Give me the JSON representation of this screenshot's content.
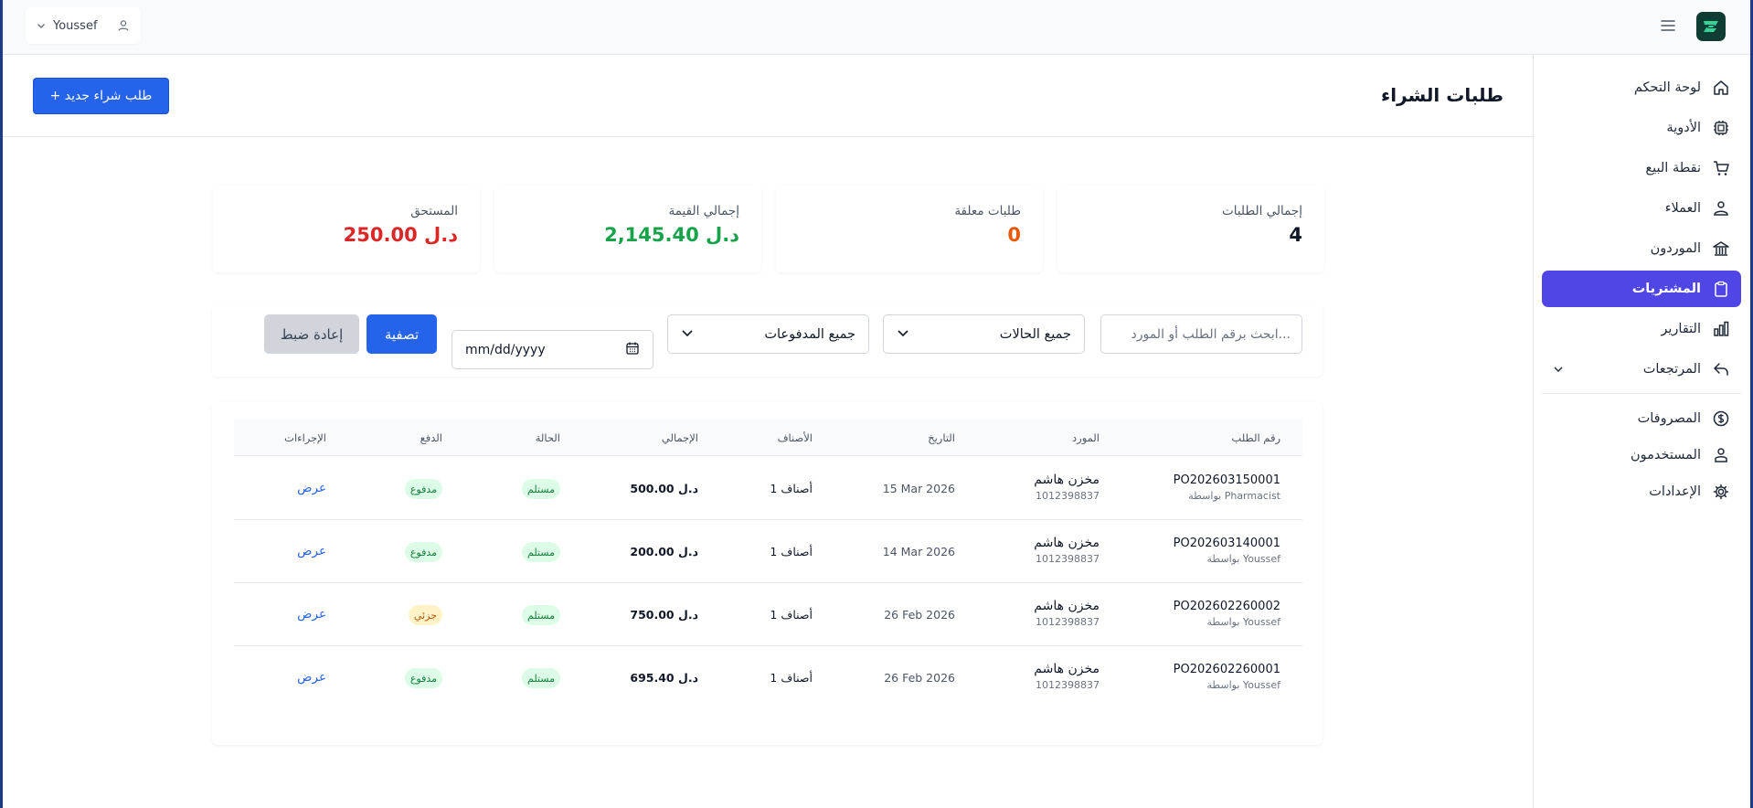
{
  "app": {
    "user_name": "Youssef"
  },
  "sidebar": {
    "items": [
      {
        "label": "لوحة التحكم",
        "icon": "home-icon",
        "active": false
      },
      {
        "label": "الأدوية",
        "icon": "pill-icon",
        "active": false
      },
      {
        "label": "نقطة البيع",
        "icon": "cart-icon",
        "active": false
      },
      {
        "label": "العملاء",
        "icon": "customers-icon",
        "active": false
      },
      {
        "label": "الموردون",
        "icon": "building-icon",
        "active": false
      },
      {
        "label": "المشتريات",
        "icon": "clipboard-icon",
        "active": true
      },
      {
        "label": "التقارير",
        "icon": "bar-chart-icon",
        "active": false
      },
      {
        "label": "المرتجعات",
        "icon": "return-arrow-icon",
        "active": false,
        "expandable": true
      },
      {
        "label": "المصروفات",
        "icon": "dollar-icon",
        "active": false
      },
      {
        "label": "المستخدمون",
        "icon": "users-icon",
        "active": false
      },
      {
        "label": "الإعدادات",
        "icon": "gear-icon",
        "active": false
      }
    ]
  },
  "header": {
    "title": "طلبات الشراء",
    "new_button": "+ طلب شراء جديد"
  },
  "stats": [
    {
      "label": "إجمالي الطلبات",
      "value": "4",
      "color": "#111827"
    },
    {
      "label": "طلبات معلقة",
      "value": "0",
      "color": "#ea580c"
    },
    {
      "label": "إجمالي القيمة",
      "value": "2,145.40 د.ل",
      "color": "#16a34a"
    },
    {
      "label": "المستحق",
      "value": "250.00 د.ل",
      "color": "#dc2626"
    }
  ],
  "filters": {
    "search_placeholder": "ابحث برقم الطلب أو المورد...",
    "status_value": "جميع الحالات",
    "payment_value": "جميع المدفوعات",
    "date_value": "mm/dd/yyyy",
    "filter_button": "تصفية",
    "reset_button": "إعادة ضبط"
  },
  "table": {
    "columns": [
      "رقم الطلب",
      "المورد",
      "التاريخ",
      "الأصناف",
      "الإجمالي",
      "الحالة",
      "الدفع",
      "الإجراءات"
    ],
    "rows": [
      {
        "po": "PO202603150001",
        "by": "بواسطة Pharmacist",
        "supplier": "مخزن هاشم",
        "supplier_id": "1012398837",
        "date": "15 Mar 2026",
        "items": "1 أصناف",
        "total": "500.00 د.ل",
        "status": "مستلم",
        "payment": "مدفوع",
        "payment_color": "green",
        "action": "عرض"
      },
      {
        "po": "PO202603140001",
        "by": "بواسطة Youssef",
        "supplier": "مخزن هاشم",
        "supplier_id": "1012398837",
        "date": "14 Mar 2026",
        "items": "1 أصناف",
        "total": "200.00 د.ل",
        "status": "مستلم",
        "payment": "مدفوع",
        "payment_color": "green",
        "action": "عرض"
      },
      {
        "po": "PO202602260002",
        "by": "بواسطة Youssef",
        "supplier": "مخزن هاشم",
        "supplier_id": "1012398837",
        "date": "26 Feb 2026",
        "items": "1 أصناف",
        "total": "750.00 د.ل",
        "status": "مستلم",
        "payment": "جزئي",
        "payment_color": "amber",
        "action": "عرض"
      },
      {
        "po": "PO202602260001",
        "by": "بواسطة Youssef",
        "supplier": "مخزن هاشم",
        "supplier_id": "1012398837",
        "date": "26 Feb 2026",
        "items": "1 أصناف",
        "total": "695.40 د.ل",
        "status": "مستلم",
        "payment": "مدفوع",
        "payment_color": "green",
        "action": "عرض"
      }
    ]
  },
  "colors": {
    "primary": "#2563eb",
    "sidebar_active": "#4f46e5"
  }
}
